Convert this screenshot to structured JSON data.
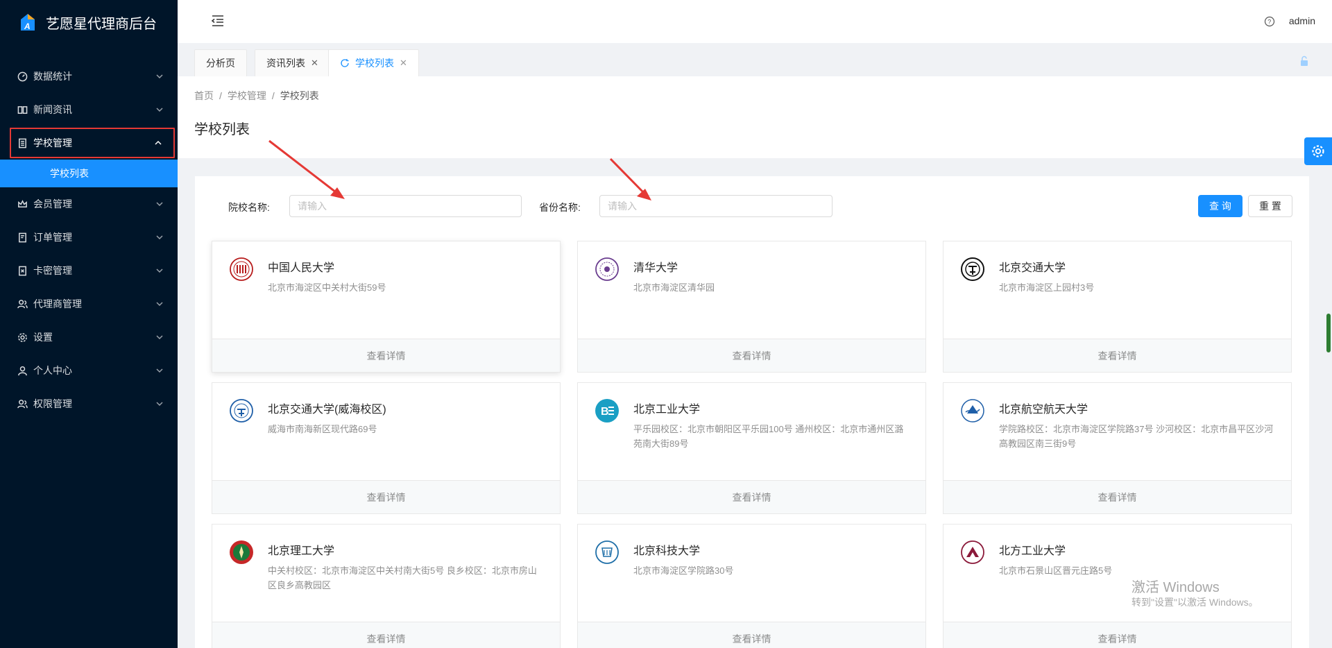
{
  "app": {
    "title": "艺愿星代理商后台"
  },
  "sidebar": {
    "items": [
      {
        "label": "数据统计",
        "icon": "dashboard-icon"
      },
      {
        "label": "新闻资讯",
        "icon": "book-icon"
      },
      {
        "label": "学校管理",
        "icon": "file-icon",
        "open": true
      },
      {
        "label": "会员管理",
        "icon": "crown-icon"
      },
      {
        "label": "订单管理",
        "icon": "order-icon"
      },
      {
        "label": "卡密管理",
        "icon": "key-card-icon"
      },
      {
        "label": "代理商管理",
        "icon": "team-icon"
      },
      {
        "label": "设置",
        "icon": "gear-icon"
      },
      {
        "label": "个人中心",
        "icon": "user-icon"
      },
      {
        "label": "权限管理",
        "icon": "team-icon"
      }
    ],
    "subitem": {
      "label": "学校列表"
    }
  },
  "header": {
    "user": "admin"
  },
  "tabs": [
    {
      "label": "分析页"
    },
    {
      "label": "资讯列表"
    },
    {
      "label": "学校列表",
      "active": true
    }
  ],
  "breadcrumb": {
    "home": "首页",
    "section": "学校管理",
    "current": "学校列表"
  },
  "page": {
    "title": "学校列表"
  },
  "search": {
    "school_label": "院校名称:",
    "school_placeholder": "请输入",
    "province_label": "省份名称:",
    "province_placeholder": "请输入",
    "query_btn": "查 询",
    "reset_btn": "重 置"
  },
  "schools": [
    {
      "name": "中国人民大学",
      "address": "北京市海淀区中关村大街59号",
      "action": "查看详情",
      "color": "#b71c1c"
    },
    {
      "name": "清华大学",
      "address": "北京市海淀区清华园",
      "action": "查看详情",
      "color": "#6a3d8f"
    },
    {
      "name": "北京交通大学",
      "address": "北京市海淀区上园村3号",
      "action": "查看详情",
      "color": "#111111"
    },
    {
      "name": "北京交通大学(威海校区)",
      "address": "威海市南海新区现代路69号",
      "action": "查看详情",
      "color": "#1f5fa8"
    },
    {
      "name": "北京工业大学",
      "address": "平乐园校区：北京市朝阳区平乐园100号 通州校区：北京市通州区潞苑南大街89号",
      "action": "查看详情",
      "color": "#1a9fc4"
    },
    {
      "name": "北京航空航天大学",
      "address": "学院路校区：北京市海淀区学院路37号 沙河校区：北京市昌平区沙河高教园区南三街9号",
      "action": "查看详情",
      "color": "#1f5fa8"
    },
    {
      "name": "北京理工大学",
      "address": "中关村校区：北京市海淀区中关村南大街5号 良乡校区：北京市房山区良乡高教园区",
      "action": "查看详情",
      "color": "#1b7a3a"
    },
    {
      "name": "北京科技大学",
      "address": "北京市海淀区学院路30号",
      "action": "查看详情",
      "color": "#1f6fa8"
    },
    {
      "name": "北方工业大学",
      "address": "北京市石景山区晋元庄路5号",
      "action": "查看详情",
      "color": "#8b1a3a"
    }
  ],
  "watermark": {
    "line1": "激活 Windows",
    "line2": "转到\"设置\"以激活 Windows。"
  },
  "colors": {
    "primary": "#1890ff",
    "sidebar": "#001529",
    "annotation": "#e53935"
  }
}
